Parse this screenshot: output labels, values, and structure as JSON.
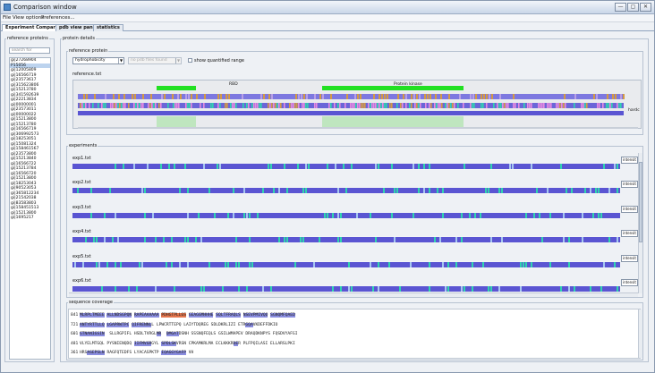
{
  "window": {
    "title": "Comparison window",
    "controls": [
      "—",
      "▢",
      "✕"
    ]
  },
  "menu": [
    "File",
    "View options",
    "Preferences..."
  ],
  "tabs": [
    {
      "label": "Experiment Comparison",
      "active": true
    },
    {
      "label": "pdb view panel",
      "active": false
    },
    {
      "label": "statistics",
      "active": false
    }
  ],
  "left_panel": {
    "title": "reference proteins",
    "search_placeholder": "search for",
    "proteins": [
      "gi|27268904",
      "P15056",
      "gi|12005809",
      "gi|16566719",
      "gi|23573617",
      "gi|315623806",
      "gi|15213780",
      "gi|341592639",
      "gi|22213834",
      "gi|00000001",
      "gi|23573011",
      "gi|00000022",
      "gi|15213800",
      "gi|15213780",
      "gi|16566719",
      "gi|306992573",
      "gi|18253051",
      "gi|15081324",
      "gi|158461567",
      "gi|23573800",
      "gi|15213840",
      "gi|16566722",
      "gi|15213784",
      "gi|16566720",
      "gi|15213800",
      "gi|18253043",
      "gi|90523053",
      "gi|365812234",
      "gi|21542038",
      "gi|83583803",
      "gi|158451513",
      "gi|15213800",
      "gi|1695217"
    ],
    "selected_index": 1
  },
  "protein_details": {
    "title": "protein details",
    "reference_group": {
      "title": "reference protein",
      "property_select": "hydrophobicity",
      "structure_select": "no pdb files found",
      "checkbox_label": "show quantified range",
      "checkbox_checked": false,
      "file_label": "reference.txt",
      "domains": [
        "RBD",
        "Protein kinase"
      ],
      "side_label": "hardc"
    },
    "experiments_group": {
      "title": "experiments",
      "button_label": "intensit",
      "experiments": [
        "exp1.txt",
        "exp2.txt",
        "exp3.txt",
        "exp4.txt",
        "exp5.txt",
        "exp6.txt"
      ]
    },
    "sequence_group": {
      "title": "sequence coverage",
      "lines": [
        {
          "num": "841",
          "segments": [
            [
              "MLRPLTMEEE",
              "h"
            ],
            [
              " ",
              "n"
            ],
            [
              "ALLNDSGPQN",
              "h"
            ],
            [
              " ",
              "n"
            ],
            [
              "RAPEAAAAAA",
              "h"
            ],
            [
              " ",
              "n"
            ],
            [
              "PDHGTPLLGS",
              "r"
            ],
            [
              " ",
              "n"
            ],
            [
              "GEAGGMHHHE",
              "h"
            ],
            [
              " ",
              "n"
            ],
            [
              "SQLTFRAQLS",
              "h"
            ],
            [
              " ",
              "n"
            ],
            [
              "NSEVPMIVQQ",
              "h"
            ],
            [
              " ",
              "n"
            ],
            [
              "SGNQMFQAED",
              "h"
            ]
          ]
        },
        {
          "num": "721",
          "segments": [
            [
              "ANTYRTTLLQ",
              "h"
            ],
            [
              " ",
              "n"
            ],
            [
              "LGAP",
              "h"
            ],
            [
              "RWTPC",
              "h"
            ],
            [
              " ",
              "n"
            ],
            [
              "QIFRENNL",
              "h"
            ],
            [
              "L LPWCRTTEPQ LAIYTDQREG SDLDKRLIZI ETR",
              "n"
            ],
            [
              "GQA",
              "h"
            ],
            [
              "VKDEFFDKIO",
              "n"
            ]
          ]
        },
        {
          "num": "601",
          "segments": [
            [
              "GTNANIGSIN",
              "h"
            ],
            [
              "  SLLRGPIFL HSDLTVRGL",
              "n"
            ],
            [
              "MR",
              "h"
            ],
            [
              "  ",
              "n"
            ],
            [
              "DMGAT",
              "h"
            ],
            [
              "DSNH SSSNQFEQLS GSILWMAPEV DRAQDKNPYS FQSDVYAFGI",
              "n"
            ]
          ]
        },
        {
          "num": "481",
          "segments": [
            [
              "VLYELMTGQL PYSNIENQDQ ",
              "n"
            ],
            [
              "IIFMVGR",
              "h"
            ],
            [
              "GYL ",
              "n"
            ],
            [
              "SPDLSK",
              "h"
            ],
            [
              "VRSN CPKAMKRLMA ECLKKKR",
              "n"
            ],
            [
              "DE",
              "h"
            ],
            [
              "R PLFPQILASI ELLARSLPKI",
              "n"
            ]
          ]
        },
        {
          "num": "361",
          "segments": [
            [
              "HRS",
              "n"
            ],
            [
              "ASEPSLN",
              "h"
            ],
            [
              " RAGFQTEDFS LYACASPKTP ",
              "n"
            ],
            [
              "IQAGGYGAFP",
              "h"
            ],
            [
              " VH",
              "n"
            ]
          ]
        }
      ]
    }
  },
  "colors": {
    "bar_base": "#5a55d2",
    "green": "#22e022",
    "orange": "#d49a44",
    "pink": "#e78ae0",
    "teal": "#2fd4b0",
    "accent_selected": "#bcd3ee"
  }
}
